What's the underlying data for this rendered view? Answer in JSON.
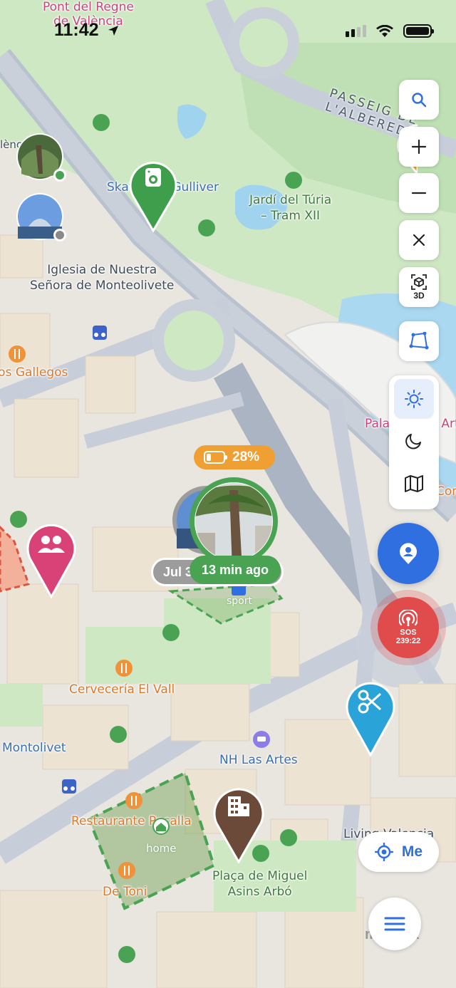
{
  "status_bar": {
    "time": "11:42"
  },
  "map": {
    "labels": {
      "pont_del_regne": "Pont del Regne\nde València",
      "skatepark": "Skatepark Gulliver",
      "jardi": "Jardí del Túria\n– Tram XII",
      "iglesia": "Iglesia de Nuestra\nSeñora de Monteolivete",
      "los_gallegos": "Los Gallegos",
      "palau": "Palau de les Arts",
      "con": "Con",
      "cerveceria": "Cervecería El Vall",
      "montolivet": "Montolivet",
      "nh": "NH Las Artes",
      "restaurante": "Restaurante Pecalla",
      "de_toni": "De Toni",
      "placa": "Plaça de Miguel\nAsins Arbó",
      "living": "Living Valencia",
      "lenc": "lènc"
    },
    "road_label": "PASSEIG DE L'ALBEREDA",
    "zones": {
      "sport": "sport",
      "home": "home"
    },
    "attribution": "mapbox"
  },
  "member": {
    "battery_percent": "28%",
    "battery_level": 0.28,
    "date_chip": "Jul 3",
    "last_seen": "13 min ago"
  },
  "controls": {
    "threed_label": "3D",
    "sos_label": "SOS",
    "sos_timer": "239:22",
    "me_label": "Me"
  },
  "colors": {
    "accent_blue": "#2f6fe0",
    "sos_red": "#e04b4b",
    "battery_orange": "#f0a032",
    "online_green": "#4aa353",
    "pin_green": "#3f9e4b",
    "pin_pink": "#d94277",
    "pin_brown": "#6b4a3a",
    "pin_cyan": "#2aa3d8"
  }
}
